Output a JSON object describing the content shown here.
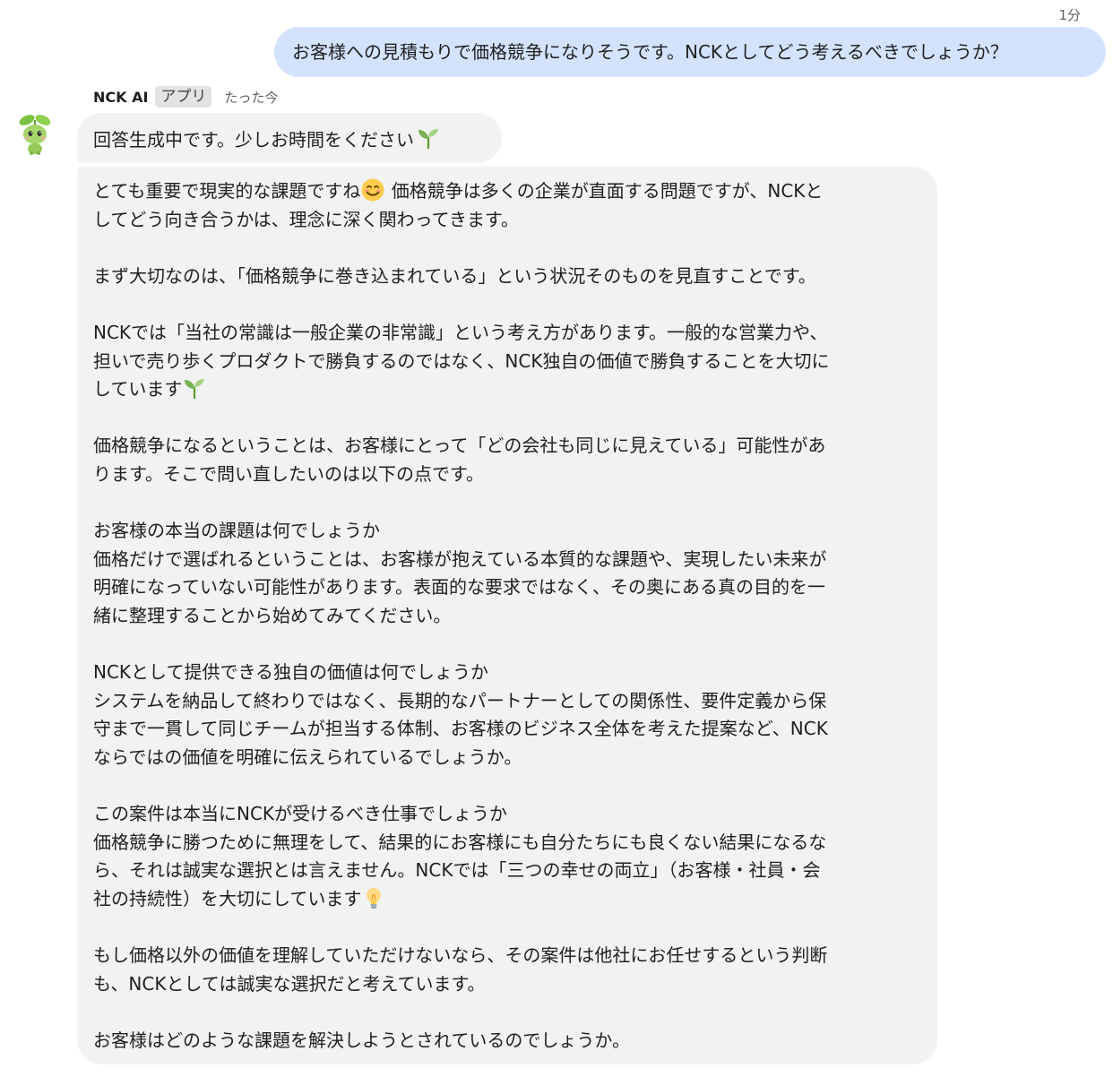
{
  "outgoing": {
    "time": "1分",
    "text": "お客様への見積もりで価格競争になりそうです。NCKとしてどう考えるべきでしょうか？"
  },
  "bot": {
    "name": "NCK AI",
    "badge": "アプリ",
    "time": "たった今"
  },
  "status_message": "回答生成中です。少しお時間をください",
  "answer": {
    "p1_a": "とても重要で現実的な課題ですね",
    "p1_b": " 価格競争は多くの企業が直面する問題ですが、NCKと",
    "p1_c": "してどう向き合うかは、理念に深く関わってきます。",
    "p2": "まず大切なのは、「価格競争に巻き込まれている」という状況そのものを見直すことです。",
    "p3_a": "NCKでは「当社の常識は一般企業の非常識」という考え方があります。一般的な営業力や、",
    "p3_b": "担いで売り歩くプロダクトで勝負するのではなく、NCK独自の価値で勝負することを大切に",
    "p3_c": "しています",
    "p4_a": "価格競争になるということは、お客様にとって「どの会社も同じに見えている」可能性があ",
    "p4_b": "ります。そこで問い直したいのは以下の点です。",
    "p5_a": "お客様の本当の課題は何でしょうか",
    "p5_b": "価格だけで選ばれるということは、お客様が抱えている本質的な課題や、実現したい未来が",
    "p5_c": "明確になっていない可能性があります。表面的な要求ではなく、その奥にある真の目的を一",
    "p5_d": "緒に整理することから始めてみてください。",
    "p6_a": "NCKとして提供できる独自の価値は何でしょうか",
    "p6_b": "システムを納品して終わりではなく、長期的なパートナーとしての関係性、要件定義から保",
    "p6_c": "守まで一貫して同じチームが担当する体制、お客様のビジネス全体を考えた提案など、NCK",
    "p6_d": "ならではの価値を明確に伝えられているでしょうか。",
    "p7_a": "この案件は本当にNCKが受けるべき仕事でしょうか",
    "p7_b": "価格競争に勝つために無理をして、結果的にお客様にも自分たちにも良くない結果になるな",
    "p7_c": "ら、それは誠実な選択とは言えません。NCKでは「三つの幸せの両立」（お客様・社員・会",
    "p7_d": "社の持続性）を大切にしています",
    "p8_a": "もし価格以外の価値を理解していただけないなら、その案件は他社にお任せするという判断",
    "p8_b": "も、NCKとしては誠実な選択だと考えています。",
    "p9": "お客様はどのような課題を解決しようとされているのでしょうか。"
  },
  "icons": {
    "avatar": "sprout-mascot-icon",
    "emoji_sprout": "seedling-icon",
    "emoji_smile": "smiling-face-icon",
    "emoji_bulb": "light-bulb-icon"
  },
  "colors": {
    "outgoing_bubble": "#d3e3fd",
    "incoming_bubble": "#f2f2f2",
    "badge_bg": "#e3e3e3"
  }
}
